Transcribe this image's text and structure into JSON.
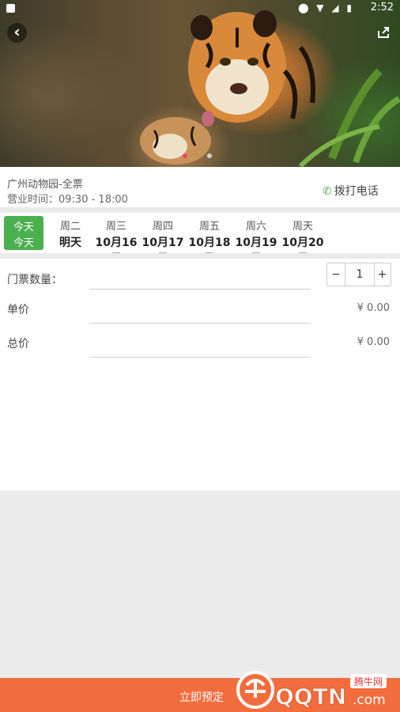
{
  "status_bar": {
    "time": "2:52"
  },
  "hero": {
    "active_slide": 1,
    "slide_count": 2
  },
  "info": {
    "park_name": "广州动物园-全票",
    "hours": "营业时间：09:30 - 18:00",
    "call_label": "拨打电话"
  },
  "dates": [
    {
      "weekday": "今天",
      "date": "今天",
      "selected": true
    },
    {
      "weekday": "周二",
      "date": "明天"
    },
    {
      "weekday": "周三",
      "date": "10月16日"
    },
    {
      "weekday": "周四",
      "date": "10月17日"
    },
    {
      "weekday": "周五",
      "date": "10月18日"
    },
    {
      "weekday": "周六",
      "date": "10月19日"
    },
    {
      "weekday": "周天",
      "date": "10月20日"
    }
  ],
  "form": {
    "quantity_label": "门票数量：",
    "quantity_value": "1",
    "minus": "−",
    "plus": "+",
    "unit_price_label": "单价",
    "unit_price_value": "¥ 0.00",
    "total_label": "总价",
    "total_value": "¥ 0.00"
  },
  "book_button": "立即预定",
  "watermark": {
    "top_text": "腾牛网",
    "main_text": "QQTN.com"
  },
  "colors": {
    "accent_green": "#4caf50",
    "book_orange": "#f26d3d"
  }
}
